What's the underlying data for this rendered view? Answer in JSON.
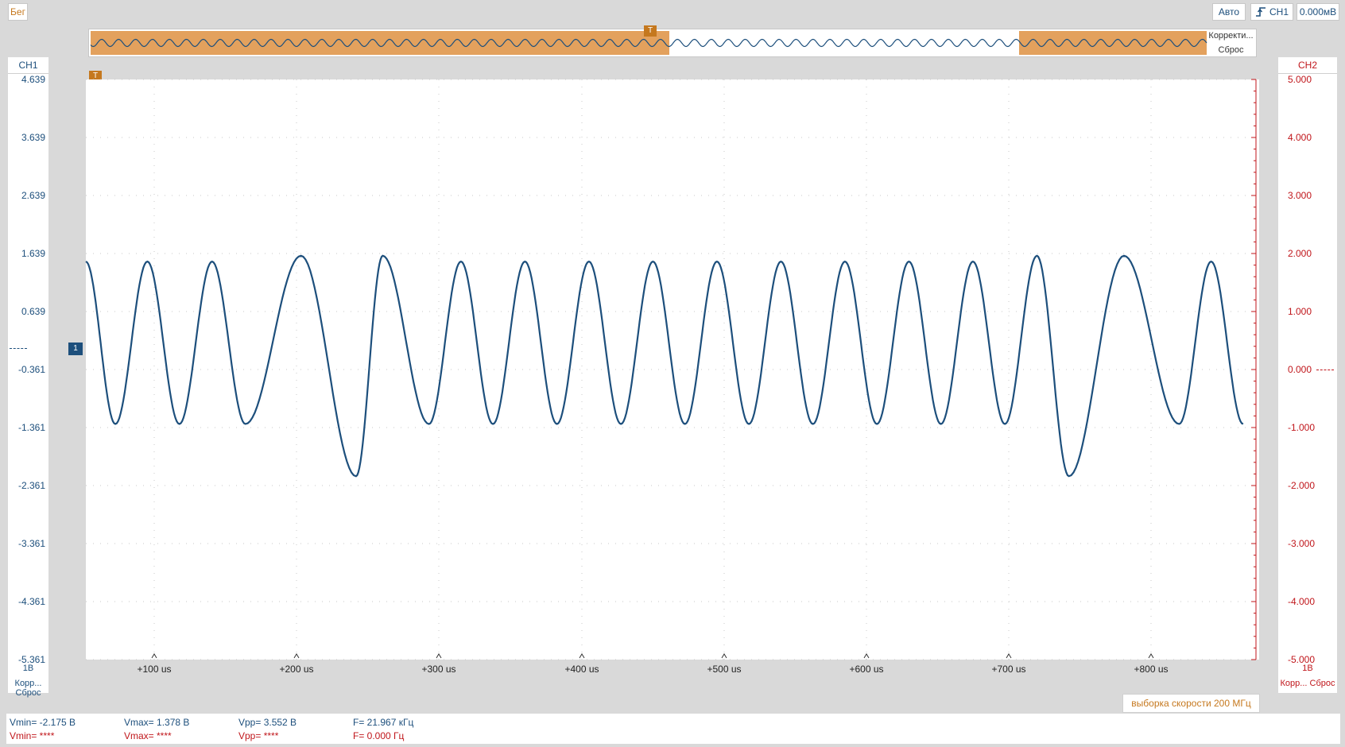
{
  "top_bar": {
    "run_status": "Бег",
    "trigger_mode": "Авто",
    "trigger_source": "CH1",
    "trigger_level": "0.000мВ"
  },
  "overview": {
    "correction_label": "Корректи...",
    "reset_label": "Сброс"
  },
  "ch1": {
    "title": "CH1",
    "scale": "1В",
    "correction": "Корр...",
    "reset": "Сброс",
    "color": "#1d4f7c",
    "ticks": [
      "4.639",
      "3.639",
      "2.639",
      "1.639",
      "0.639",
      "-0.361",
      "-1.361",
      "-2.361",
      "-3.361",
      "-4.361",
      "-5.361"
    ]
  },
  "ch2": {
    "title": "CH2",
    "scale": "1В",
    "correction": "Корр...",
    "reset": "Сброс",
    "color": "#c0161b",
    "ticks": [
      "5.000",
      "4.000",
      "3.000",
      "2.000",
      "1.000",
      "0.000",
      "-1.000",
      "-2.000",
      "-3.000",
      "-4.000",
      "-5.000"
    ]
  },
  "time_axis": {
    "labels": [
      "+100 us",
      "+200 us",
      "+300 us",
      "+400 us",
      "+500 us",
      "+600 us",
      "+700 us",
      "+800 us"
    ]
  },
  "sample_rate": "выборка скорости 200 МГц",
  "measurements": {
    "ch1": {
      "vmin": "Vmin= -2.175 В",
      "vmax": "Vmax= 1.378 В",
      "vpp": "Vpp= 3.552 В",
      "freq": "F= 21.967 кГц"
    },
    "ch2": {
      "vmin": "Vmin= ****",
      "vmax": "Vmax= ****",
      "vpp": "Vpp= ****",
      "freq": "F= 0.000 Гц"
    }
  },
  "chart_data": {
    "type": "line",
    "series": [
      {
        "name": "CH1",
        "x": [
          0,
          8.3,
          17.3,
          26.3,
          35.5,
          44.9,
          60.5,
          76,
          83.5,
          96.5,
          105.5,
          114.5,
          123.5,
          132.5,
          141.5,
          150.5,
          159.5,
          168.5,
          177.5,
          186.5,
          195.5,
          204.5,
          213.5,
          222.5,
          231.5,
          240.5,
          249.5,
          258.5,
          267.5,
          276.5,
          292,
          307.5,
          316.5,
          325.5
        ],
        "y": [
          1.5,
          -1.3,
          1.5,
          -1.3,
          1.5,
          -1.3,
          1.6,
          -2.2,
          1.6,
          -1.3,
          1.5,
          -1.3,
          1.5,
          -1.3,
          1.5,
          -1.3,
          1.5,
          -1.3,
          1.5,
          -1.3,
          1.5,
          -1.3,
          1.5,
          -1.3,
          1.5,
          -1.3,
          1.5,
          -1.3,
          1.6,
          -2.2,
          1.6,
          -1.3,
          1.5,
          -1.3
        ]
      }
    ],
    "x_labels": [
      "+100 us",
      "+200 us",
      "+300 us",
      "+400 us",
      "+500 us",
      "+600 us",
      "+700 us",
      "+800 us"
    ],
    "ylim_ch1": [
      -5.361,
      4.639
    ],
    "ylim_ch2": [
      -5.0,
      5.0
    ],
    "grid": true
  }
}
